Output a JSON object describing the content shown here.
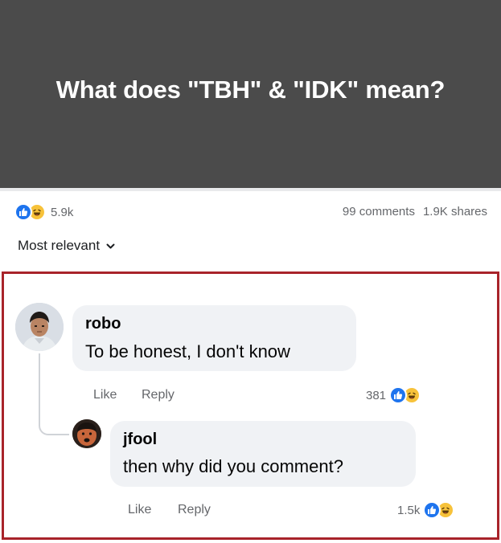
{
  "post": {
    "title": "What does \"TBH\" & \"IDK\" mean?",
    "reaction_count": "5.9k",
    "comments_count": "99 comments",
    "shares_count": "1.9K shares"
  },
  "sort": {
    "label": "Most relevant"
  },
  "comments": [
    {
      "author": "robo",
      "text": "To be honest, I don't know",
      "like_label": "Like",
      "reply_label": "Reply",
      "reaction_count": "381"
    },
    {
      "author": "jfool",
      "text": "then why did you comment?",
      "like_label": "Like",
      "reply_label": "Reply",
      "reaction_count": "1.5k"
    }
  ],
  "colors": {
    "banner": "#4b4b4b",
    "like_blue": "#1e74ee",
    "haha_yellow": "#f7c23a",
    "highlight_border": "#a8232a",
    "bubble": "#f0f2f5"
  },
  "icons": [
    "like-icon",
    "haha-icon",
    "chevron-down-icon"
  ]
}
